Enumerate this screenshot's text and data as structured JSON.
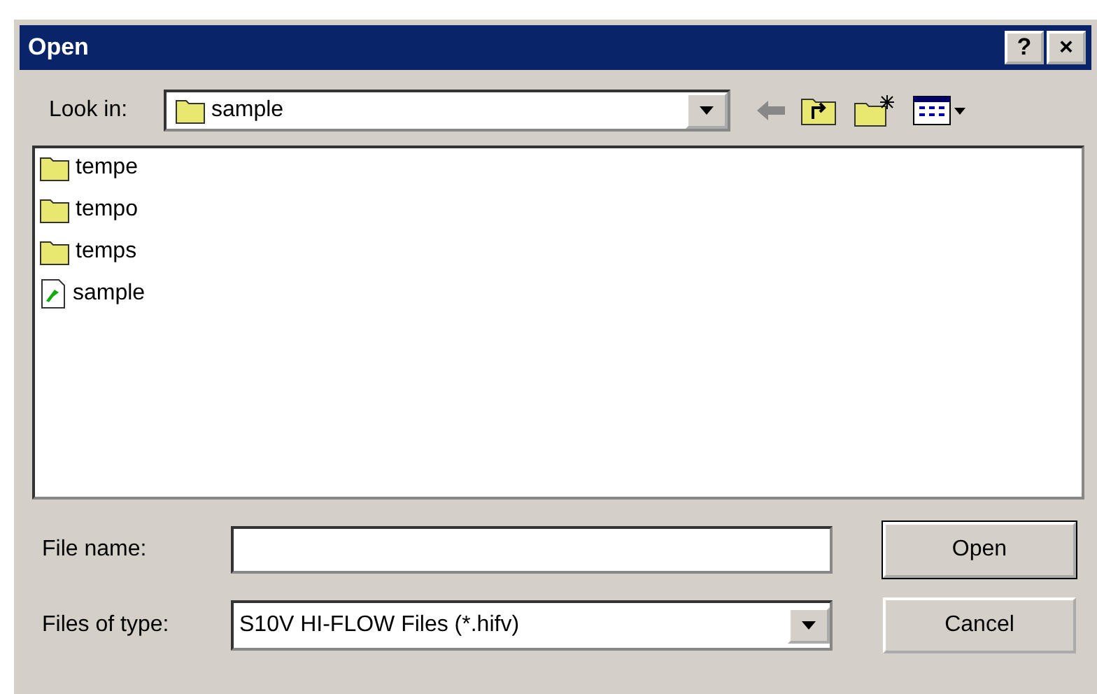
{
  "window": {
    "title": "Open",
    "title_buttons": [
      "?",
      "×"
    ]
  },
  "look_in": {
    "label": "Look in:",
    "value": "sample"
  },
  "files": [
    {
      "name": "tempe",
      "kind": "folder"
    },
    {
      "name": "tempo",
      "kind": "folder"
    },
    {
      "name": "temps",
      "kind": "folder"
    },
    {
      "name": "sample",
      "kind": "document"
    }
  ],
  "file_name": {
    "label": "File name:"
  },
  "file_type": {
    "label": "Files of type:",
    "value": "S10V HI-FLOW Files (*.hifv)"
  },
  "buttons": [
    "Open",
    "Cancel"
  ]
}
